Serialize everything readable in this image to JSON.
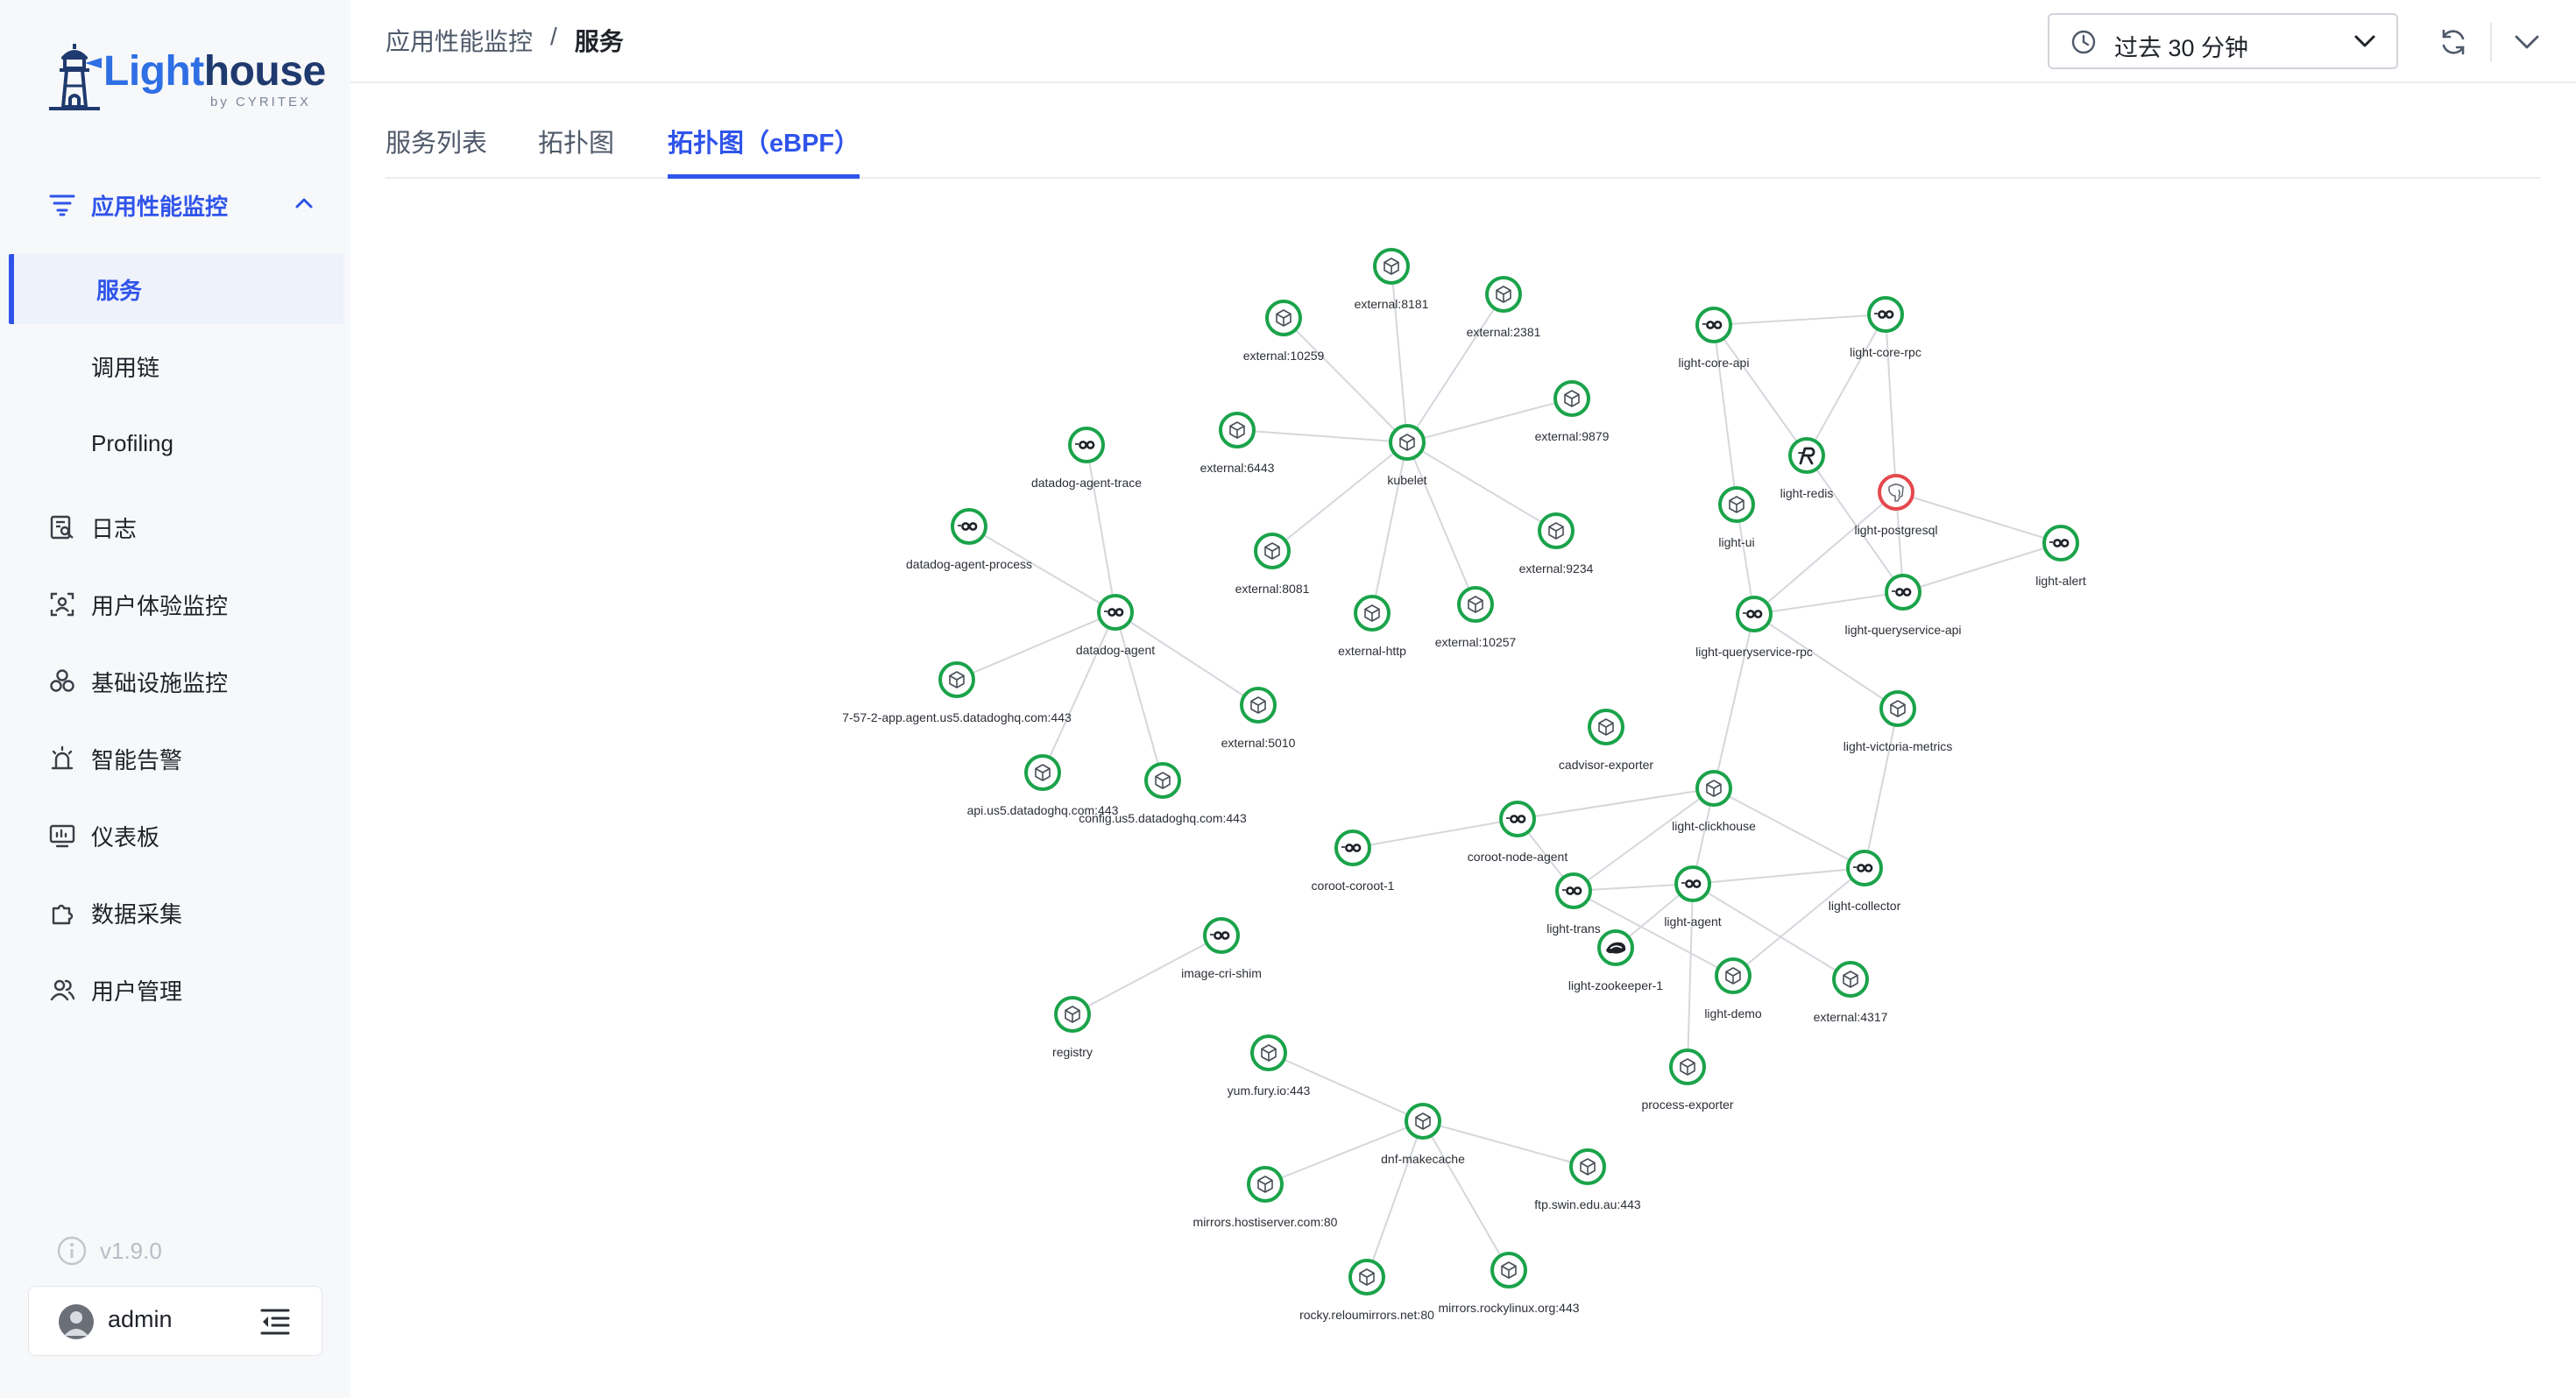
{
  "app": {
    "brand_pre": "Light",
    "brand_post": "house",
    "brand_sub": "by CYRITEX"
  },
  "sidebar": {
    "groups": [
      {
        "label": "应用性能监控",
        "icon": "apm-filter-icon",
        "expanded": true,
        "children": [
          {
            "label": "服务",
            "active": true
          },
          {
            "label": "调用链"
          },
          {
            "label": "Profiling"
          }
        ]
      },
      {
        "label": "日志",
        "icon": "log-search-icon"
      },
      {
        "label": "用户体验监控",
        "icon": "user-scan-icon"
      },
      {
        "label": "基础设施监控",
        "icon": "infra-cluster-icon"
      },
      {
        "label": "智能告警",
        "icon": "alarm-light-icon"
      },
      {
        "label": "仪表板",
        "icon": "dashboard-monitor-icon"
      },
      {
        "label": "数据采集",
        "icon": "puzzle-icon"
      },
      {
        "label": "用户管理",
        "icon": "users-icon"
      }
    ],
    "version": "v1.9.0",
    "user": {
      "name": "admin"
    }
  },
  "header": {
    "breadcrumb": {
      "parent": "应用性能监控",
      "separator": "/",
      "current": "服务"
    },
    "time_range": "过去 30 分钟"
  },
  "tabs": [
    {
      "label": "服务列表",
      "active": false
    },
    {
      "label": "拓扑图",
      "active": false
    },
    {
      "label": "拓扑图（eBPF）",
      "active": true
    }
  ],
  "colors": {
    "accent": "#2f54eb",
    "node_ok": "#1aa34a",
    "node_error": "#e5484d",
    "edge": "#d4d7dc"
  },
  "topology": {
    "nodes": [
      {
        "id": "kubelet",
        "label": "kubelet",
        "type": "cube",
        "status": "ok"
      },
      {
        "id": "external:8181",
        "label": "external:8181",
        "type": "cube",
        "status": "ok"
      },
      {
        "id": "external:2381",
        "label": "external:2381",
        "type": "cube",
        "status": "ok"
      },
      {
        "id": "external:10259",
        "label": "external:10259",
        "type": "cube",
        "status": "ok"
      },
      {
        "id": "external:9879",
        "label": "external:9879",
        "type": "cube",
        "status": "ok"
      },
      {
        "id": "external:6443",
        "label": "external:6443",
        "type": "cube",
        "status": "ok"
      },
      {
        "id": "external:9234",
        "label": "external:9234",
        "type": "cube",
        "status": "ok"
      },
      {
        "id": "external:8081",
        "label": "external:8081",
        "type": "cube",
        "status": "ok"
      },
      {
        "id": "external:10257",
        "label": "external:10257",
        "type": "cube",
        "status": "ok"
      },
      {
        "id": "external-http",
        "label": "external-http",
        "type": "cube",
        "status": "ok"
      },
      {
        "id": "datadog-agent-trace",
        "label": "datadog-agent-trace",
        "type": "go",
        "status": "ok"
      },
      {
        "id": "datadog-agent-process",
        "label": "datadog-agent-process",
        "type": "go",
        "status": "ok"
      },
      {
        "id": "datadog-agent",
        "label": "datadog-agent",
        "type": "go",
        "status": "ok"
      },
      {
        "id": "app-agent",
        "label": "7-57-2-app.agent.us5.datadoghq.com:443",
        "type": "cube",
        "status": "ok"
      },
      {
        "id": "external:5010",
        "label": "external:5010",
        "type": "cube",
        "status": "ok"
      },
      {
        "id": "api-dd",
        "label": "api.us5.datadoghq.com:443",
        "type": "cube",
        "status": "ok"
      },
      {
        "id": "config-dd",
        "label": "config.us5.datadoghq.com:443",
        "type": "cube",
        "status": "ok"
      },
      {
        "id": "light-core-api",
        "label": "light-core-api",
        "type": "go",
        "status": "ok"
      },
      {
        "id": "light-core-rpc",
        "label": "light-core-rpc",
        "type": "go",
        "status": "ok"
      },
      {
        "id": "light-redis",
        "label": "light-redis",
        "type": "redis",
        "status": "ok"
      },
      {
        "id": "light-postgresql",
        "label": "light-postgresql",
        "type": "postgres",
        "status": "error"
      },
      {
        "id": "light-ui",
        "label": "light-ui",
        "type": "cube",
        "status": "ok"
      },
      {
        "id": "light-alert",
        "label": "light-alert",
        "type": "go",
        "status": "ok"
      },
      {
        "id": "light-queryservice-api",
        "label": "light-queryservice-api",
        "type": "go",
        "status": "ok"
      },
      {
        "id": "light-queryservice-rpc",
        "label": "light-queryservice-rpc",
        "type": "go",
        "status": "ok"
      },
      {
        "id": "light-victoria-metrics",
        "label": "light-victoria-metrics",
        "type": "cube",
        "status": "ok"
      },
      {
        "id": "cadvisor-exporter",
        "label": "cadvisor-exporter",
        "type": "cube",
        "status": "ok"
      },
      {
        "id": "light-clickhouse",
        "label": "light-clickhouse",
        "type": "cube",
        "status": "ok"
      },
      {
        "id": "coroot-node-agent",
        "label": "coroot-node-agent",
        "type": "go",
        "status": "ok"
      },
      {
        "id": "coroot-coroot-1",
        "label": "coroot-coroot-1",
        "type": "go",
        "status": "ok"
      },
      {
        "id": "light-collector",
        "label": "light-collector",
        "type": "go",
        "status": "ok"
      },
      {
        "id": "light-agent",
        "label": "light-agent",
        "type": "go",
        "status": "ok"
      },
      {
        "id": "light-trans",
        "label": "light-trans",
        "type": "go",
        "status": "ok"
      },
      {
        "id": "light-zookeeper-1",
        "label": "light-zookeeper-1",
        "type": "zookeeper",
        "status": "ok"
      },
      {
        "id": "light-demo",
        "label": "light-demo",
        "type": "cube",
        "status": "ok"
      },
      {
        "id": "external:4317",
        "label": "external:4317",
        "type": "cube",
        "status": "ok"
      },
      {
        "id": "process-exporter",
        "label": "process-exporter",
        "type": "cube",
        "status": "ok"
      },
      {
        "id": "image-cri-shim",
        "label": "image-cri-shim",
        "type": "go",
        "status": "ok"
      },
      {
        "id": "registry",
        "label": "registry",
        "type": "cube",
        "status": "ok"
      },
      {
        "id": "yum.fury.io:443",
        "label": "yum.fury.io:443",
        "type": "cube",
        "status": "ok"
      },
      {
        "id": "dnf-makecache",
        "label": "dnf-makecache",
        "type": "cube",
        "status": "ok"
      },
      {
        "id": "mirrors.hostiserver.com:80",
        "label": "mirrors.hostiserver.com:80",
        "type": "cube",
        "status": "ok"
      },
      {
        "id": "ftp.swin.edu.au:443",
        "label": "ftp.swin.edu.au:443",
        "type": "cube",
        "status": "ok"
      },
      {
        "id": "rocky.reloumirrors.net:80",
        "label": "rocky.reloumirrors.net:80",
        "type": "cube",
        "status": "ok"
      },
      {
        "id": "mirrors.rockylinux.org:443",
        "label": "mirrors.rockylinux.org:443",
        "type": "cube",
        "status": "ok"
      }
    ],
    "edges": [
      [
        "kubelet",
        "external:8181"
      ],
      [
        "kubelet",
        "external:2381"
      ],
      [
        "kubelet",
        "external:10259"
      ],
      [
        "kubelet",
        "external:9879"
      ],
      [
        "kubelet",
        "external:6443"
      ],
      [
        "kubelet",
        "external:9234"
      ],
      [
        "kubelet",
        "external:8081"
      ],
      [
        "kubelet",
        "external:10257"
      ],
      [
        "kubelet",
        "external-http"
      ],
      [
        "datadog-agent",
        "datadog-agent-trace"
      ],
      [
        "datadog-agent",
        "datadog-agent-process"
      ],
      [
        "datadog-agent",
        "app-agent"
      ],
      [
        "datadog-agent",
        "external:5010"
      ],
      [
        "datadog-agent",
        "api-dd"
      ],
      [
        "datadog-agent",
        "config-dd"
      ],
      [
        "light-core-api",
        "light-core-rpc"
      ],
      [
        "light-core-api",
        "light-redis"
      ],
      [
        "light-core-api",
        "light-ui"
      ],
      [
        "light-core-rpc",
        "light-redis"
      ],
      [
        "light-core-rpc",
        "light-postgresql"
      ],
      [
        "light-redis",
        "light-queryservice-api"
      ],
      [
        "light-postgresql",
        "light-alert"
      ],
      [
        "light-postgresql",
        "light-queryservice-api"
      ],
      [
        "light-postgresql",
        "light-queryservice-rpc"
      ],
      [
        "light-alert",
        "light-queryservice-api"
      ],
      [
        "light-ui",
        "light-queryservice-rpc"
      ],
      [
        "light-queryservice-api",
        "light-queryservice-rpc"
      ],
      [
        "light-queryservice-rpc",
        "light-victoria-metrics"
      ],
      [
        "light-queryservice-rpc",
        "light-clickhouse"
      ],
      [
        "light-clickhouse",
        "light-collector"
      ],
      [
        "light-clickhouse",
        "light-trans"
      ],
      [
        "light-clickhouse",
        "light-agent"
      ],
      [
        "light-clickhouse",
        "coroot-node-agent"
      ],
      [
        "light-victoria-metrics",
        "light-collector"
      ],
      [
        "coroot-node-agent",
        "coroot-coroot-1"
      ],
      [
        "coroot-node-agent",
        "light-trans"
      ],
      [
        "light-agent",
        "light-collector"
      ],
      [
        "light-agent",
        "light-trans"
      ],
      [
        "light-agent",
        "process-exporter"
      ],
      [
        "light-agent",
        "external:4317"
      ],
      [
        "light-collector",
        "light-demo"
      ],
      [
        "light-trans",
        "light-demo"
      ],
      [
        "light-agent",
        "light-zookeeper-1"
      ],
      [
        "image-cri-shim",
        "registry"
      ],
      [
        "dnf-makecache",
        "yum.fury.io:443"
      ],
      [
        "dnf-makecache",
        "mirrors.hostiserver.com:80"
      ],
      [
        "dnf-makecache",
        "ftp.swin.edu.au:443"
      ],
      [
        "dnf-makecache",
        "rocky.reloumirrors.net:80"
      ],
      [
        "dnf-makecache",
        "mirrors.rockylinux.org:443"
      ]
    ]
  }
}
